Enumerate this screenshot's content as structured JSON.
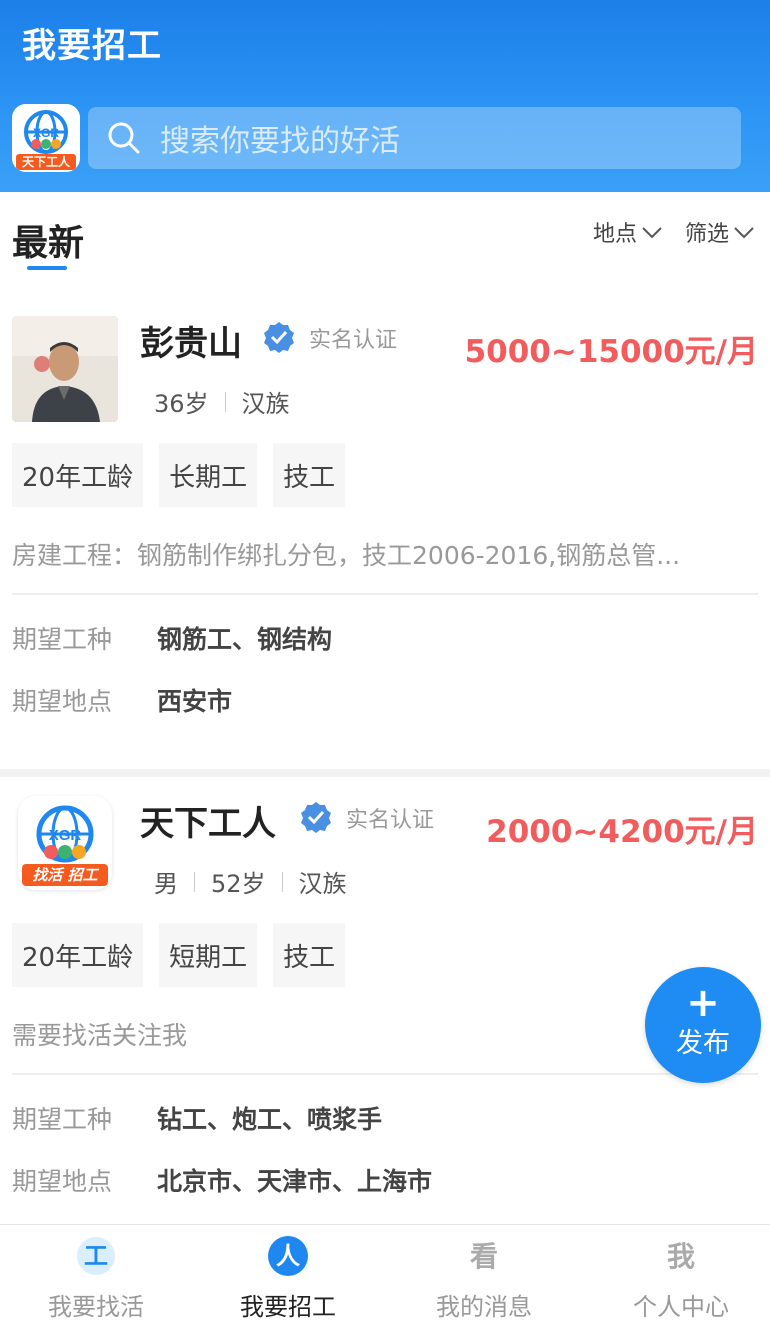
{
  "header": {
    "title": "我要招工",
    "logo_text": "天下工人",
    "search_placeholder": "搜索你要找的好活"
  },
  "tabs": {
    "latest": "最新",
    "filter_location": "地点",
    "filter_screen": "筛选"
  },
  "cards": [
    {
      "name": "彭贵山",
      "verified_label": "实名认证",
      "salary": "5000~15000元/月",
      "meta": [
        "36岁",
        "汉族"
      ],
      "tags": [
        "20年工龄",
        "长期工",
        "技工"
      ],
      "description": "房建工程：钢筋制作绑扎分包，技工2006-2016,钢筋总管...",
      "job_type_label": "期望工种",
      "job_type_value": "钢筋工、钢结构",
      "location_label": "期望地点",
      "location_value": "西安市"
    },
    {
      "name": "天下工人",
      "verified_label": "实名认证",
      "salary": "2000~4200元/月",
      "avatar_text": "找活 招工",
      "meta": [
        "男",
        "52岁",
        "汉族"
      ],
      "tags": [
        "20年工龄",
        "短期工",
        "技工"
      ],
      "description": "需要找活关注我",
      "job_type_label": "期望工种",
      "job_type_value": "钻工、炮工、喷浆手",
      "location_label": "期望地点",
      "location_value": "北京市、天津市、上海市"
    }
  ],
  "fab": {
    "plus": "+",
    "label": "发布"
  },
  "bottom_nav": [
    {
      "label": "我要找活",
      "icon": "worker-icon",
      "glyph": "工"
    },
    {
      "label": "我要招工",
      "icon": "person-icon",
      "glyph": "人",
      "active": true
    },
    {
      "label": "我的消息",
      "icon": "message-icon",
      "glyph": "看"
    },
    {
      "label": "个人中心",
      "icon": "profile-icon",
      "glyph": "我"
    }
  ],
  "colors": {
    "brand_blue": "#1e88f0",
    "salary_red": "#f25c5c"
  }
}
